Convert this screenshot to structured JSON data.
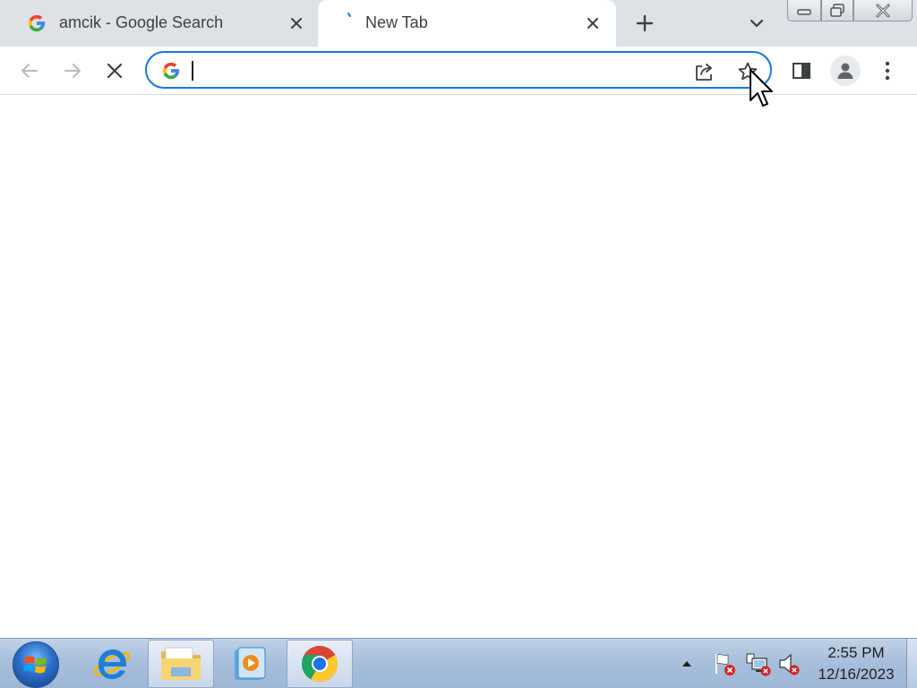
{
  "tabs": [
    {
      "title": "amcik - Google Search",
      "favicon": "google-g-icon",
      "active": false
    },
    {
      "title": "New Tab",
      "favicon": "loading-spinner-icon",
      "active": true
    }
  ],
  "toolbar": {
    "back_icon": "arrow-left-icon",
    "forward_icon": "arrow-right-icon",
    "stop_icon": "close-x-icon",
    "omnibox": {
      "value": "",
      "placeholder": "",
      "search_icon": "google-g-icon"
    },
    "share_icon": "share-icon",
    "bookmark_icon": "star-outline-icon",
    "side_panel_icon": "side-panel-icon",
    "profile_icon": "person-avatar-icon",
    "menu_icon": "kebab-menu-icon"
  },
  "colors": {
    "tabstrip_bg": "#dee1e6",
    "omnibox_border": "#1a73e8",
    "google_blue": "#4285f4",
    "google_red": "#ea4335",
    "google_yellow": "#fbbc05",
    "google_green": "#34a853",
    "taskbar_bg": "#a9c0dc"
  },
  "taskbar": {
    "apps": [
      {
        "name": "internet-explorer",
        "icon": "ie-icon",
        "active": false
      },
      {
        "name": "file-explorer",
        "icon": "folder-icon",
        "active": false
      },
      {
        "name": "media-player",
        "icon": "media-player-icon",
        "active": false
      },
      {
        "name": "chrome",
        "icon": "chrome-icon",
        "active": true
      }
    ],
    "tray_icons": [
      "show-hidden-icons-arrow",
      "action-center-flag-icon",
      "network-icon",
      "volume-muted-icon"
    ],
    "clock": {
      "time": "2:55 PM",
      "date": "12/16/2023"
    }
  }
}
